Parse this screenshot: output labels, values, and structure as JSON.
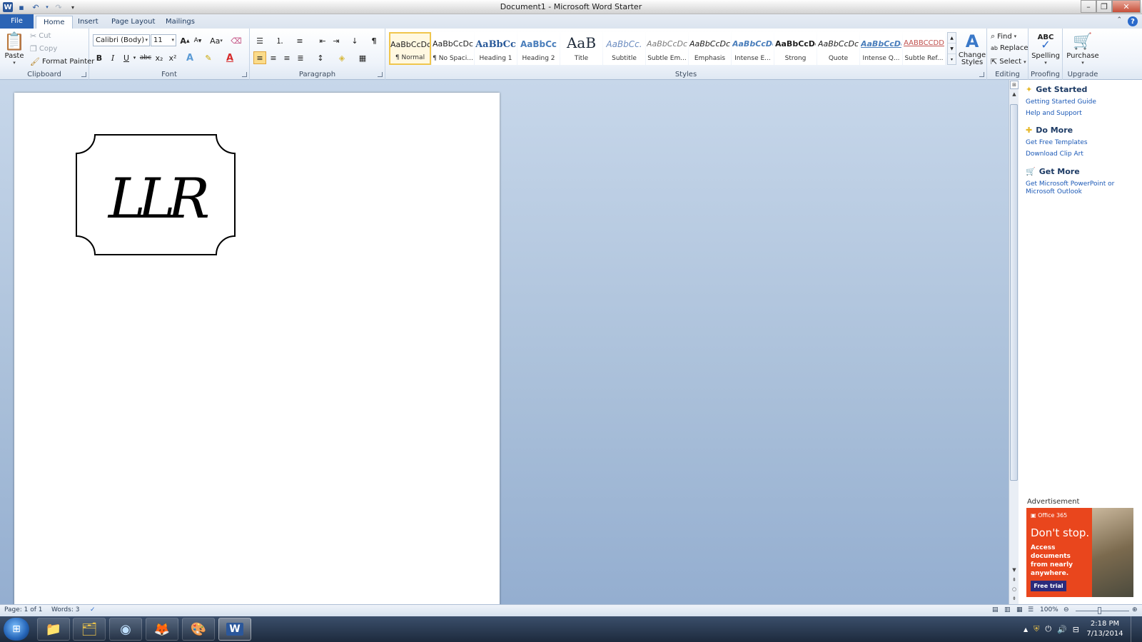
{
  "window": {
    "title": "Document1  -  Microsoft Word Starter"
  },
  "tabs": [
    {
      "label": "File"
    },
    {
      "label": "Home"
    },
    {
      "label": "Insert"
    },
    {
      "label": "Page Layout"
    },
    {
      "label": "Mailings"
    }
  ],
  "ribbon": {
    "clipboard": {
      "label": "Clipboard",
      "paste": "Paste",
      "cut": "Cut",
      "copy": "Copy",
      "format_painter": "Format Painter"
    },
    "font": {
      "label": "Font",
      "family": "Calibri (Body)",
      "size": "11",
      "change_case": "Aa",
      "bold": "B",
      "italic": "I",
      "underline": "U",
      "strike": "abc",
      "sub": "x₂",
      "sup": "x²"
    },
    "paragraph": {
      "label": "Paragraph"
    },
    "styles": {
      "label": "Styles",
      "items": [
        {
          "sample": "AaBbCcDc",
          "name": "¶ Normal"
        },
        {
          "sample": "AaBbCcDc",
          "name": "¶ No Spaci..."
        },
        {
          "sample": "AaBbCc",
          "name": "Heading 1"
        },
        {
          "sample": "AaBbCc",
          "name": "Heading 2"
        },
        {
          "sample": "AaB",
          "name": "Title"
        },
        {
          "sample": "AaBbCc.",
          "name": "Subtitle"
        },
        {
          "sample": "AaBbCcDc",
          "name": "Subtle Em..."
        },
        {
          "sample": "AaBbCcDc",
          "name": "Emphasis"
        },
        {
          "sample": "AaBbCcDc",
          "name": "Intense E..."
        },
        {
          "sample": "AaBbCcDc",
          "name": "Strong"
        },
        {
          "sample": "AaBbCcDc",
          "name": "Quote"
        },
        {
          "sample": "AaBbCcDc",
          "name": "Intense Q..."
        },
        {
          "sample": "AABBCCDD",
          "name": "Subtle Ref..."
        }
      ],
      "change_styles": "Change Styles"
    },
    "editing": {
      "label": "Editing",
      "find": "Find",
      "replace": "Replace",
      "select": "Select"
    },
    "proofing": {
      "label": "Proofing",
      "spelling": "Spelling",
      "abc": "ABC"
    },
    "upgrade": {
      "label": "Upgrade",
      "purchase": "Purchase"
    }
  },
  "document": {
    "monogram": "LLR"
  },
  "taskpane": {
    "get_started": {
      "title": "Get Started",
      "links": [
        "Getting Started Guide",
        "Help and Support"
      ]
    },
    "do_more": {
      "title": "Do More",
      "links": [
        "Get Free Templates",
        "Download Clip Art"
      ]
    },
    "get_more": {
      "title": "Get More",
      "links": [
        "Get Microsoft PowerPoint or Microsoft Outlook"
      ]
    },
    "ad": {
      "label": "Advertisement",
      "brand": "Office 365",
      "headline": "Don't stop.",
      "body": "Access documents from nearly anywhere.",
      "cta": "Free trial"
    }
  },
  "statusbar": {
    "page": "Page: 1 of 1",
    "words": "Words: 3",
    "zoom": "100%"
  },
  "taskbar": {
    "time": "2:18 PM",
    "date": "7/13/2014"
  },
  "colors": {
    "accent": "#2b64b5",
    "ad_bg": "#e9461d"
  }
}
